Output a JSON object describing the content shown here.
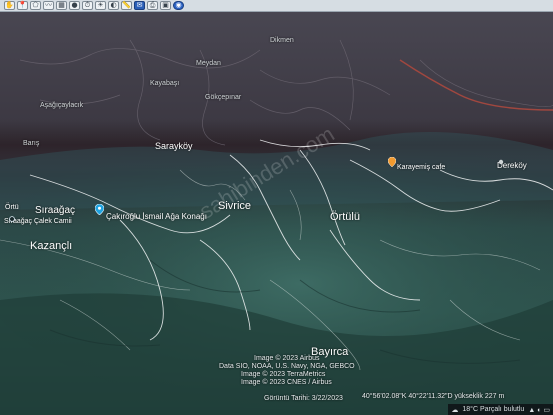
{
  "toolbar": {
    "buttons": [
      {
        "name": "hand-tool-icon",
        "glyph": "✋",
        "style": ""
      },
      {
        "name": "placemark-icon",
        "glyph": "📍",
        "style": ""
      },
      {
        "name": "polygon-icon",
        "glyph": "⬠",
        "style": ""
      },
      {
        "name": "path-icon",
        "glyph": "〰",
        "style": ""
      },
      {
        "name": "overlay-icon",
        "glyph": "▦",
        "style": ""
      },
      {
        "name": "record-tour-icon",
        "glyph": "●",
        "style": ""
      },
      {
        "name": "history-icon",
        "glyph": "⏱",
        "style": ""
      },
      {
        "name": "sun-icon",
        "glyph": "☀",
        "style": ""
      },
      {
        "name": "planet-icon",
        "glyph": "◐",
        "style": ""
      },
      {
        "name": "ruler-icon",
        "glyph": "📏",
        "style": ""
      },
      {
        "name": "email-icon",
        "glyph": "✉",
        "style": "blue"
      },
      {
        "name": "print-icon",
        "glyph": "⎙",
        "style": ""
      },
      {
        "name": "save-image-icon",
        "glyph": "▣",
        "style": ""
      },
      {
        "name": "view-in-maps-icon",
        "glyph": "◉",
        "style": "round"
      }
    ]
  },
  "places": {
    "kazancli": "Kazançlı",
    "siraagac": "Sıraağaç",
    "siraagac_mosque": "Sıraağaç Çalek Camii",
    "sarayköy": "Sarayköy",
    "sivrice": "Sivrice",
    "ortulu": "Örtülü",
    "bayirca": "Bayırca",
    "derekoy": "Dereköy",
    "karayemis": "Karayemiş cafe",
    "cakiroglu": "Çakıroğlu İsmail Ağa Konağı",
    "baris": "Barış",
    "ortu": "Örtü",
    "gokcepinar": "Gökçepınar",
    "asagi": "Aşağıçaylacık",
    "far1": "Dikmen",
    "far2": "Meydan",
    "far3": "Kayabaşı"
  },
  "footer": {
    "attributions": [
      "Image © 2023 Airbus",
      "Data SIO, NOAA, U.S. Navy, NGA, GEBCO",
      "Image © 2023 TerraMetrics",
      "Image © 2023 CNES / Airbus"
    ],
    "date": "Görüntü Tarihi: 3/22/2023",
    "coords": "40°56'02.08\"K  40°22'11.32\"D  yükseklik  227 m",
    "watermark": "sahibinden.com"
  },
  "status": {
    "weather": "18°C Parçalı bulutlu",
    "tray": "▲ ◐ ▭"
  },
  "colors": {
    "pin_blue": "#1fa3e0",
    "pin_orange": "#f29a2e",
    "road_white": "#f4f6f7",
    "ridge_green": "#2f5b52"
  }
}
